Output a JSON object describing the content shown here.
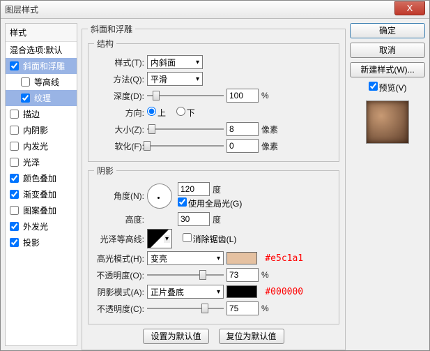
{
  "window": {
    "title": "图层样式"
  },
  "buttons": {
    "ok": "确定",
    "cancel": "取消",
    "newstyle": "新建样式(W)...",
    "preview": "预览(V)",
    "setdefault": "设置为默认值",
    "resetdefault": "复位为默认值",
    "close": "X"
  },
  "left": {
    "header": "样式",
    "blending": "混合选项:默认",
    "bevel": "斜面和浮雕",
    "contour": "等高线",
    "texture": "纹理",
    "stroke": "描边",
    "innershadow": "内阴影",
    "innerglow": "内发光",
    "satin": "光泽",
    "coloroverlay": "颜色叠加",
    "gradientoverlay": "渐变叠加",
    "patternoverlay": "图案叠加",
    "outerglow": "外发光",
    "dropshadow": "投影"
  },
  "groups": {
    "main": "斜面和浮雕",
    "structure": "结构",
    "shading": "阴影"
  },
  "labels": {
    "style": "样式(T):",
    "technique": "方法(Q):",
    "depth": "深度(D):",
    "direction": "方向:",
    "up": "上",
    "down": "下",
    "size": "大小(Z):",
    "soften": "软化(F):",
    "angle": "角度(N):",
    "useglobal": "使用全局光(G)",
    "altitude": "高度:",
    "glosscontour": "光泽等高线:",
    "antialias": "消除锯齿(L)",
    "highlightmode": "高光模式(H):",
    "opacity1": "不透明度(O):",
    "shadowmode": "阴影模式(A):",
    "opacity2": "不透明度(C):",
    "degree": "度",
    "percent": "%",
    "px": "像素"
  },
  "values": {
    "style": "内斜面",
    "technique": "平滑",
    "depth": "100",
    "size": "8",
    "soften": "0",
    "angle": "120",
    "altitude": "30",
    "highlightmode": "变亮",
    "opacity1": "73",
    "shadowmode": "正片叠底",
    "opacity2": "75"
  },
  "colors": {
    "highlight": "#e5c1a1",
    "shadow": "#000000"
  },
  "chk": {
    "bevel": true,
    "contour": false,
    "texture": true,
    "stroke": false,
    "innershadow": false,
    "innerglow": false,
    "satin": false,
    "coloroverlay": true,
    "gradientoverlay": true,
    "patternoverlay": false,
    "outerglow": true,
    "dropshadow": true,
    "useglobal": true,
    "antialias": false,
    "preview": true,
    "dir_up": true
  },
  "notes": {
    "hl": "#e5c1a1",
    "sh": "#000000"
  }
}
